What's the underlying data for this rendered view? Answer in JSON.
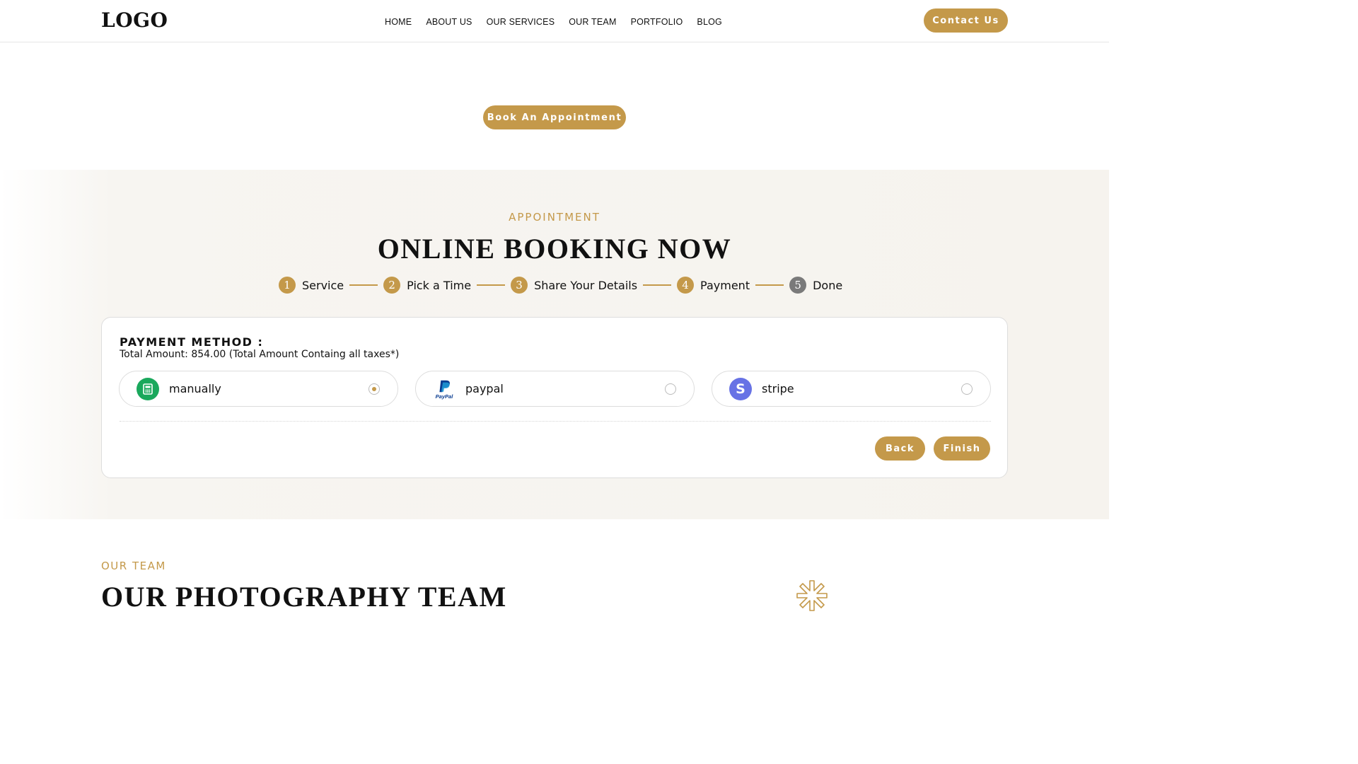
{
  "header": {
    "logo": "LOGO",
    "nav": [
      "HOME",
      "ABOUT US",
      "OUR SERVICES",
      "OUR TEAM",
      "PORTFOLIO",
      "BLOG"
    ],
    "contact_label": "Contact Us"
  },
  "hero": {
    "book_label": "Book An Appointment"
  },
  "booking": {
    "eyebrow": "APPOINTMENT",
    "title": "ONLINE BOOKING NOW",
    "steps": [
      {
        "num": "1",
        "label": "Service",
        "state": "done"
      },
      {
        "num": "2",
        "label": "Pick a Time",
        "state": "done"
      },
      {
        "num": "3",
        "label": "Share Your Details",
        "state": "done"
      },
      {
        "num": "4",
        "label": "Payment",
        "state": "current"
      },
      {
        "num": "5",
        "label": "Done",
        "state": "upcoming"
      }
    ],
    "payment": {
      "title": "PAYMENT METHOD :",
      "total": "Total Amount: 854.00 (Total Amount Containg all taxes*)",
      "options": [
        {
          "label": "manually",
          "icon": "cash-register-icon",
          "selected": true
        },
        {
          "label": "paypal",
          "icon": "paypal-icon",
          "icon_text": "PayPal",
          "selected": false
        },
        {
          "label": "stripe",
          "icon": "stripe-icon",
          "icon_text": "S",
          "selected": false
        }
      ],
      "back_label": "Back",
      "finish_label": "Finish"
    }
  },
  "team": {
    "eyebrow": "OUR TEAM",
    "title": "OUR PHOTOGRAPHY TEAM"
  },
  "colors": {
    "accent": "#c4994a",
    "inactive_step": "#7a7a7a",
    "manual_icon": "#1aa85c",
    "paypal_dark": "#0b3d91",
    "paypal_light": "#1e9ad6",
    "stripe": "#6772e5"
  }
}
